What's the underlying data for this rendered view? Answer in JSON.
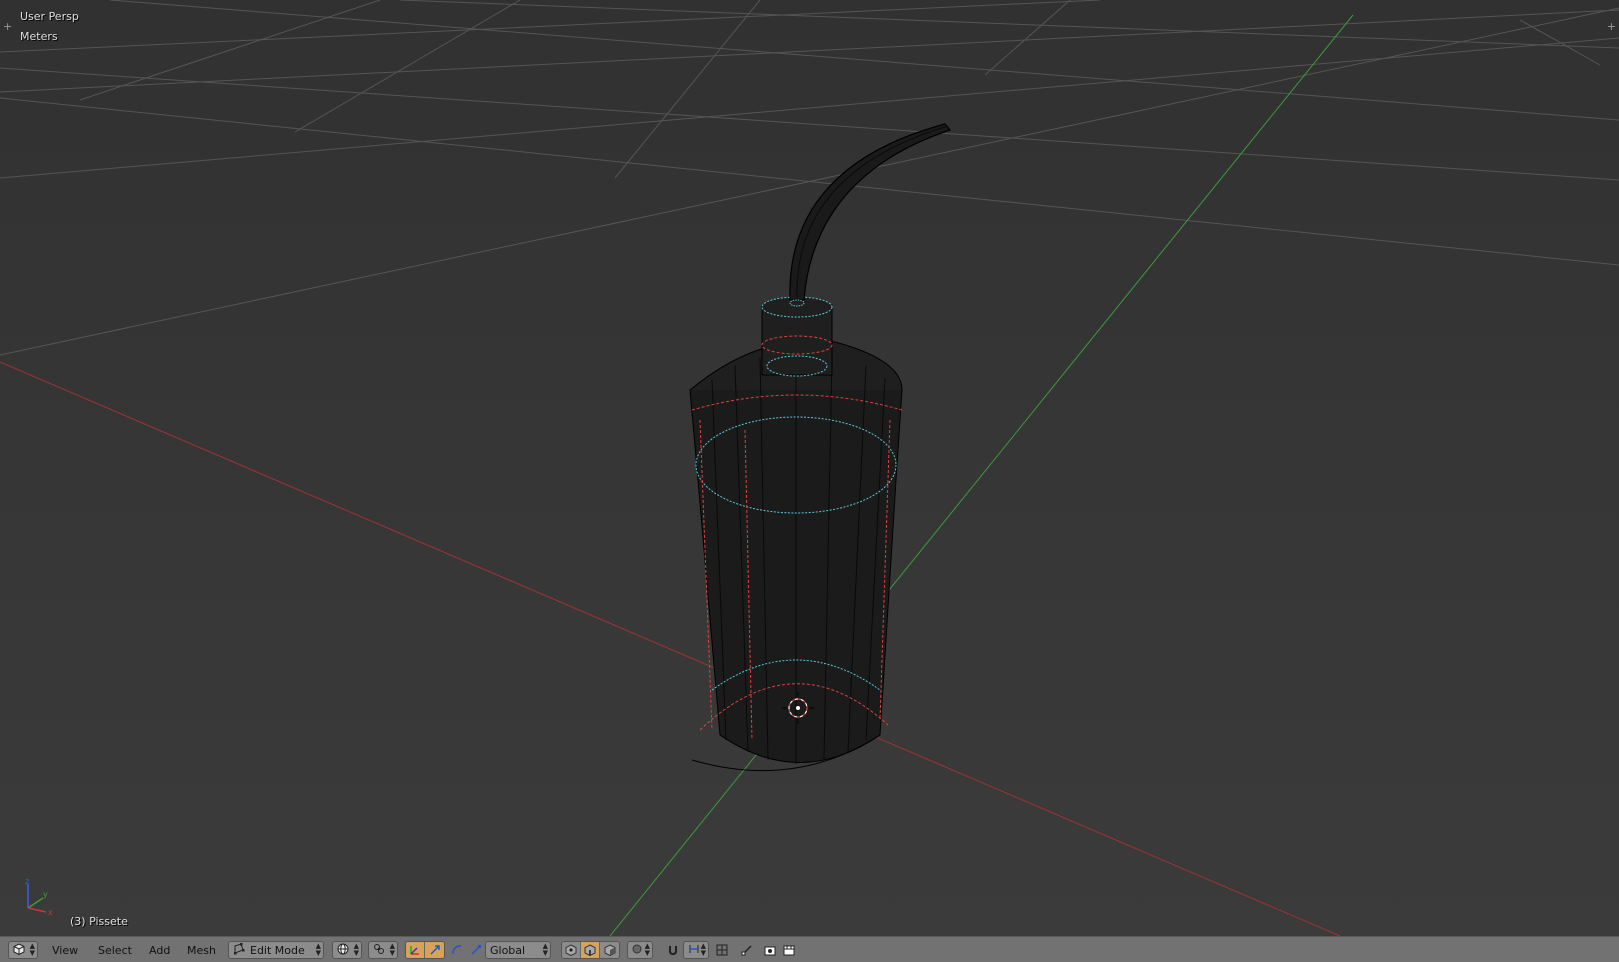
{
  "viewport": {
    "view_name": "User Persp",
    "units": "Meters",
    "object_info": "(3) Pissete"
  },
  "gizmo": {
    "y_label": "y",
    "x_label": "x",
    "z_label": "z"
  },
  "header": {
    "menus": [
      "View",
      "Select",
      "Add",
      "Mesh"
    ],
    "mode": "Edit Mode",
    "orientation": "Global"
  },
  "icons": {
    "editor_type": "view3d-cube-icon",
    "mode": "edit-mode-icon",
    "shading": "viewport-shading-sphere-icon",
    "pivot": "pivot-point-icon",
    "manipulators": [
      "manipulator-toggle-icon",
      "translate-arrow-icon",
      "rotate-arc-icon",
      "scale-arrow-icon"
    ],
    "select_modes": [
      "vertex-select-icon",
      "edge-select-icon",
      "face-select-icon"
    ],
    "proportional": "proportional-edit-icon",
    "snap": [
      "snap-magnet-icon",
      "snap-element-icon",
      "snap-target-icon"
    ],
    "render": [
      "opengl-render-icon",
      "opengl-animation-icon"
    ]
  },
  "colors": {
    "background_top": "#313131",
    "background_bottom": "#3b3b3b",
    "x_axis": "#a03232",
    "y_axis": "#3c9a3c",
    "selected_edge": "#57c9d9",
    "seam_edge": "#e04040",
    "header_bg": "#727272",
    "active_button": "#d6a25c"
  }
}
